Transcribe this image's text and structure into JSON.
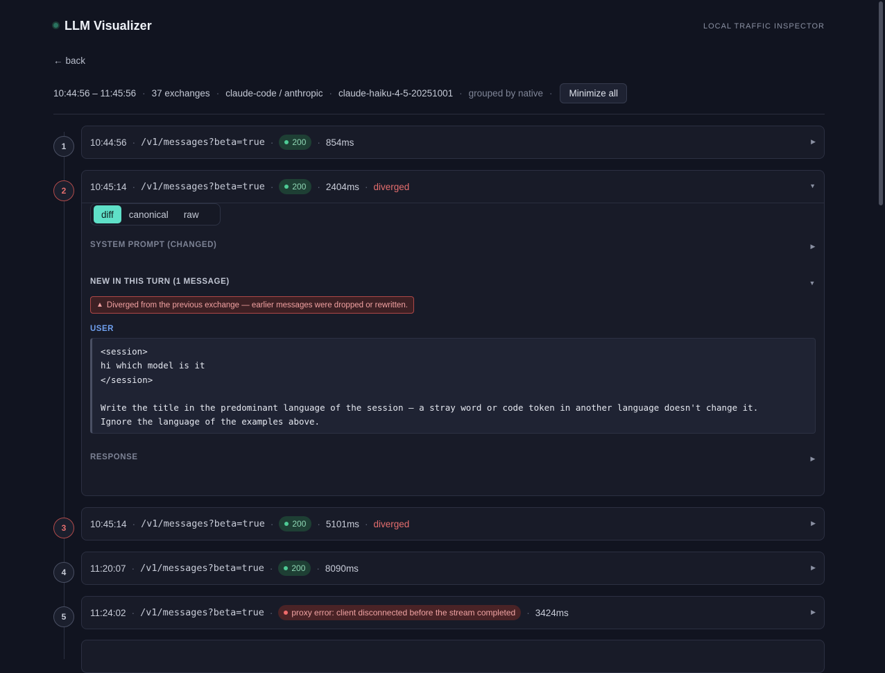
{
  "header": {
    "title": "LLM Visualizer",
    "tagline": "LOCAL TRAFFIC INSPECTOR"
  },
  "nav": {
    "back_label": "back"
  },
  "session": {
    "time_range": "10:44:56 – 11:45:56",
    "exchanges": "37 exchanges",
    "client": "claude-code / anthropic",
    "model": "claude-haiku-4-5-20251001",
    "grouping": "grouped by native",
    "minimize_label": "Minimize all"
  },
  "exchanges": [
    {
      "index": "1",
      "time": "10:44:56",
      "path": "/v1/messages?beta=true",
      "status": "200",
      "duration": "854ms",
      "flag": ""
    },
    {
      "index": "2",
      "time": "10:45:14",
      "path": "/v1/messages?beta=true",
      "status": "200",
      "duration": "2404ms",
      "flag": "diverged"
    },
    {
      "index": "3",
      "time": "10:45:14",
      "path": "/v1/messages?beta=true",
      "status": "200",
      "duration": "5101ms",
      "flag": "diverged"
    },
    {
      "index": "4",
      "time": "11:20:07",
      "path": "/v1/messages?beta=true",
      "status": "200",
      "duration": "8090ms",
      "flag": ""
    },
    {
      "index": "5",
      "time": "11:24:02",
      "path": "/v1/messages?beta=true",
      "status": "proxy error: client disconnected before the stream completed",
      "duration": "3424ms",
      "flag": ""
    }
  ],
  "detail": {
    "tabs": [
      "diff",
      "canonical",
      "raw"
    ],
    "active_tab": "diff",
    "system_prompt_label": "SYSTEM PROMPT (CHANGED)",
    "new_turn_label": "NEW IN THIS TURN (1 MESSAGE)",
    "warning": "Diverged from the previous exchange — earlier messages were dropped or rewritten.",
    "role": "USER",
    "message": "<session>\nhi which model is it\n</session>\n\nWrite the title in the predominant language of the session — a stray word or code token in another language doesn't change it.\nIgnore the language of the examples above.",
    "response_label": "RESPONSE"
  },
  "colors": {
    "background": "#111420",
    "accent": "#5fe0c8",
    "ok": "#4ecb95",
    "error": "#e56e6e",
    "user_role": "#6fa0ef"
  }
}
